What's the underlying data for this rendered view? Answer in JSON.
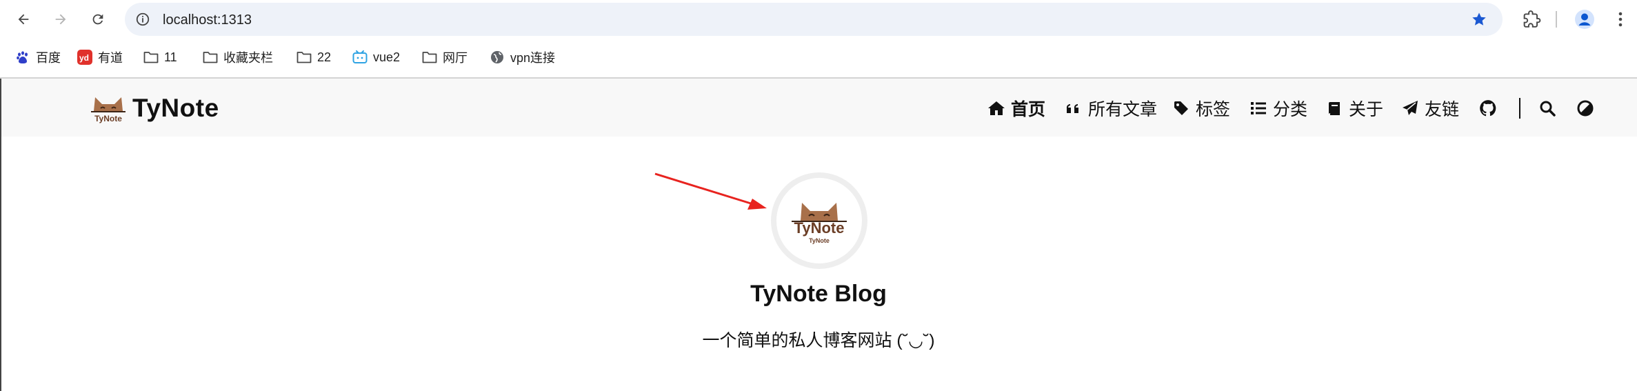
{
  "browser": {
    "url": "localhost:1313",
    "bookmarks": [
      "百度",
      "有道",
      "11",
      "收藏夹栏",
      "22",
      "vue2",
      "网厅",
      "vpn连接"
    ]
  },
  "site": {
    "brand": "TyNote",
    "logo_text": "TyNote",
    "logo_small": "TyNote",
    "menu": [
      "首页",
      "所有文章",
      "标签",
      "分类",
      "关于",
      "友链"
    ],
    "title": "TyNote Blog",
    "subtitle": "一个简单的私人博客网站 (˘◡˘)",
    "brand_color": "#a8704a",
    "annotation_color": "#e8231f"
  }
}
